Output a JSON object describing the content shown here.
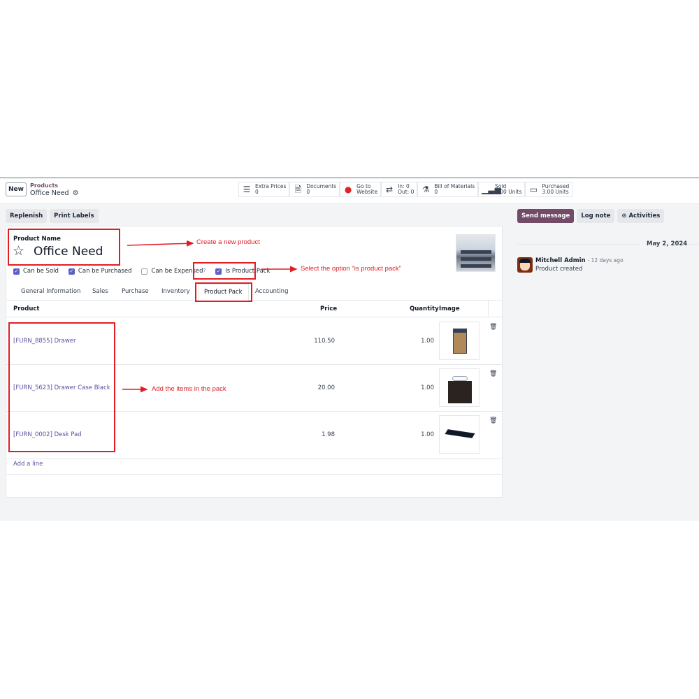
{
  "header": {
    "new_label": "New",
    "breadcrumb_parent": "Products",
    "breadcrumb_current": "Office Need"
  },
  "smart_buttons": [
    {
      "icon": "list-icon",
      "line1": "Extra Prices",
      "line2": "0"
    },
    {
      "icon": "document-icon",
      "line1": "Documents",
      "line2": "0"
    },
    {
      "icon": "globe-icon",
      "line1": "Go to",
      "line2": "Website"
    },
    {
      "icon": "transfer-icon",
      "line1": "In: 0",
      "line2": "Out: 0"
    },
    {
      "icon": "flask-icon",
      "line1": "Bill of Materials",
      "line2": "0"
    },
    {
      "icon": "bar-chart-icon",
      "line1": "Sold",
      "line2": "2.00 Units"
    },
    {
      "icon": "card-icon",
      "line1": "Purchased",
      "line2": "3.00 Units"
    }
  ],
  "actions": {
    "replenish": "Replenish",
    "print_labels": "Print Labels"
  },
  "form": {
    "name_label": "Product Name",
    "name_value": "Office Need",
    "checks": {
      "can_be_sold": "Can be Sold",
      "can_be_purchased": "Can be Purchased",
      "can_be_expensed": "Can be Expensed",
      "help_mark": "?",
      "is_product_pack": "Is Product Pack"
    },
    "tabs": [
      "General Information",
      "Sales",
      "Purchase",
      "Inventory",
      "Product Pack",
      "Accounting"
    ]
  },
  "table": {
    "headers": {
      "product": "Product",
      "price": "Price",
      "quantity": "Quantity",
      "image": "Image"
    },
    "rows": [
      {
        "product": "[FURN_8855] Drawer",
        "price": "110.50",
        "quantity": "1.00"
      },
      {
        "product": "[FURN_5623] Drawer Case Black",
        "price": "20.00",
        "quantity": "1.00"
      },
      {
        "product": "[FURN_0002] Desk Pad",
        "price": "1.98",
        "quantity": "1.00"
      }
    ],
    "add_line": "Add a line"
  },
  "chatter": {
    "send_message": "Send message",
    "log_note": "Log note",
    "activities": "Activities",
    "date": "May 2, 2024",
    "author": "Mitchell Admin",
    "ago": "- 12 days ago",
    "body": "Product created"
  },
  "annotations": {
    "create": "Create a new product",
    "select": "Select the option \"is product pack\"",
    "add_items": "Add the items in the pack"
  },
  "colors": {
    "annotation": "#e11d24",
    "primary": "#714b67",
    "checkbox": "#5b5fc7",
    "link": "#5b4e9e"
  }
}
